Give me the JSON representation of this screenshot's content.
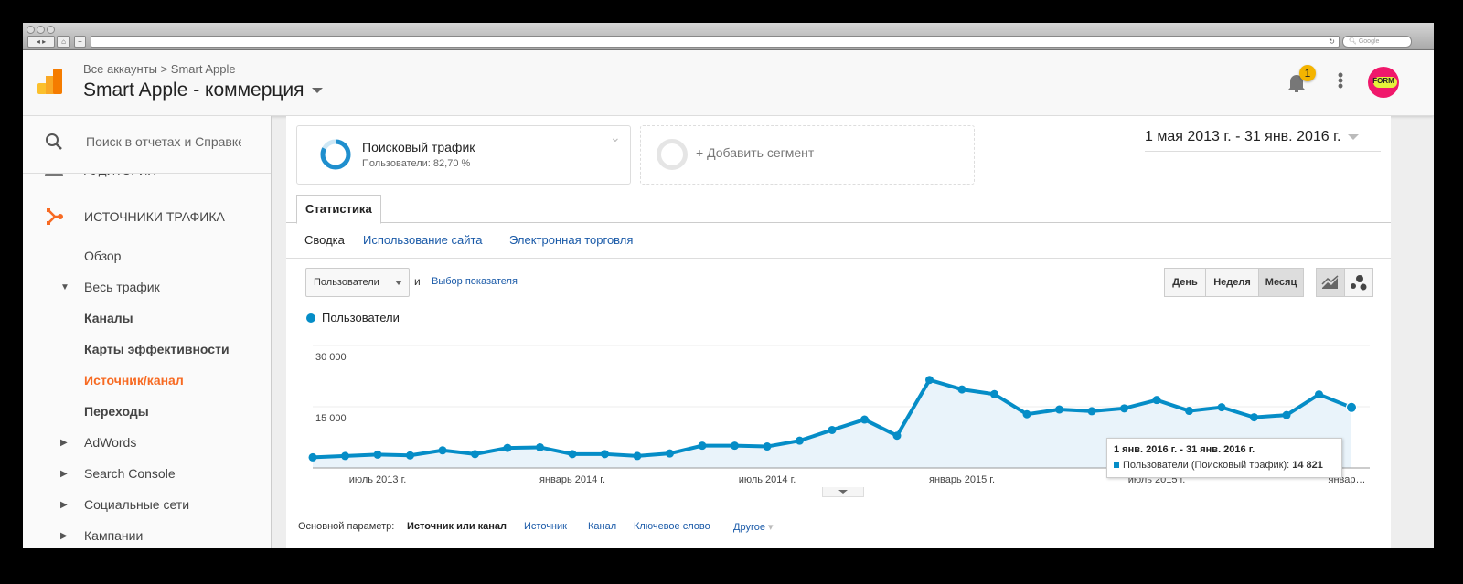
{
  "browser": {
    "search_placeholder": "Google"
  },
  "header": {
    "breadcrumb": "Все аккаунты > Smart Apple",
    "title": "Smart Apple - коммерция",
    "notification_count": "1",
    "avatar_text": "FORM"
  },
  "sidebar": {
    "search_placeholder": "Поиск в отчетах и Справке",
    "partial_item": "АУДИТОРИЯ",
    "section": "ИСТОЧНИКИ ТРАФИКА",
    "items": [
      {
        "label": "Обзор"
      },
      {
        "label": "Весь трафик",
        "arrow": "▼"
      },
      {
        "label": "Каналы"
      },
      {
        "label": "Карты эффективности"
      },
      {
        "label": "Источник/канал",
        "active": true
      },
      {
        "label": "Переходы"
      },
      {
        "label": "AdWords",
        "arrow": "▶"
      },
      {
        "label": "Search Console",
        "arrow": "▶"
      },
      {
        "label": "Социальные сети",
        "arrow": "▶"
      },
      {
        "label": "Кампании",
        "arrow": "▶"
      }
    ],
    "active_color": "#f76a22"
  },
  "segments": {
    "seg1_title": "Поисковый трафик",
    "seg1_sub": "Пользователи: 82,70 %",
    "add": "+ Добавить сегмент"
  },
  "date_range": "1 мая 2013 г. - 31 янв. 2016 г.",
  "tabs": {
    "main": "Статистика",
    "sub": [
      "Сводка",
      "Использование сайта",
      "Электронная торговля"
    ]
  },
  "controls": {
    "metric": "Пользователи",
    "and": "и",
    "choose_metric": "Выбор показателя",
    "periods": [
      "День",
      "Неделя",
      "Месяц"
    ],
    "active_period": "Месяц"
  },
  "chart_data": {
    "type": "area",
    "legend": "Пользователи",
    "color": "#058dc7",
    "yticks": [
      "30 000",
      "15 000"
    ],
    "ylim": [
      0,
      30000
    ],
    "xlabels": [
      "июль 2013 г.",
      "январь 2014 г.",
      "июль 2014 г.",
      "январь 2015 г.",
      "июль 2015 г.",
      "январ…"
    ],
    "start": "2013-05",
    "interval": "month",
    "values": [
      2590,
      2930,
      3270,
      3070,
      4300,
      3400,
      4900,
      5050,
      3400,
      3400,
      2930,
      3550,
      5450,
      5450,
      5250,
      6680,
      9300,
      11860,
      7900,
      21550,
      19230,
      18070,
      13160,
      14320,
      13900,
      14590,
      16640,
      13980,
      14860,
      12400,
      12950,
      18000,
      14821
    ],
    "tooltip": {
      "title": "1 янв. 2016 г. - 31 янв. 2016 г.",
      "label": "Пользователи (Поисковый трафик):",
      "value": "14 821"
    }
  },
  "dimension": {
    "label": "Основной параметр:",
    "active": "Источник или канал",
    "options": [
      "Источник",
      "Канал",
      "Ключевое слово",
      "Другое"
    ]
  }
}
